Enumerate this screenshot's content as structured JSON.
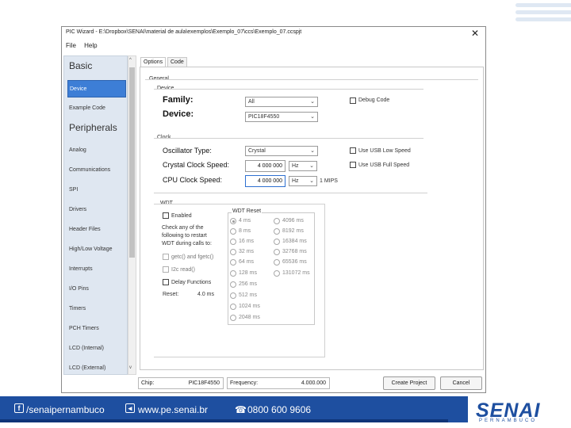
{
  "window": {
    "title": "PIC Wizard - E:\\Dropbox\\SENAI\\material de aula\\exemplos\\Exemplo_07\\ccs\\Exemplo_07.ccspjt",
    "close_glyph": "✕"
  },
  "menu": {
    "file": "File",
    "help": "Help"
  },
  "sidebar": {
    "scroll_up": "^",
    "scroll_down": "v",
    "basic_header": "Basic",
    "peripherals_header": "Peripherals",
    "items": [
      {
        "label": "Device"
      },
      {
        "label": "Example Code"
      },
      {
        "label": "Analog"
      },
      {
        "label": "Communications"
      },
      {
        "label": "SPI"
      },
      {
        "label": "Drivers"
      },
      {
        "label": "Header Files"
      },
      {
        "label": "High/Low Voltage"
      },
      {
        "label": "Interrupts"
      },
      {
        "label": "I/O Pins"
      },
      {
        "label": "Timers"
      },
      {
        "label": "PCH Timers"
      },
      {
        "label": "LCD (Internal)"
      },
      {
        "label": "LCD (External)"
      }
    ]
  },
  "tabs": {
    "options": "Options",
    "code": "Code"
  },
  "general": {
    "group_label": "General",
    "device_group": "Device",
    "family_label": "Family:",
    "family_value": "All",
    "device_label": "Device:",
    "device_value": "PIC18F4550",
    "debug_code": "Debug Code",
    "clock_group": "Clock",
    "osc_label": "Oscillator Type:",
    "osc_value": "Crystal",
    "crystal_label": "Crystal Clock Speed:",
    "crystal_value": "4 000 000",
    "crystal_unit": "Hz",
    "cpu_label": "CPU Clock Speed:",
    "cpu_value": "4 000 000",
    "cpu_unit": "Hz",
    "mips": "1 MIPS",
    "usb_low": "Use USB Low Speed",
    "usb_full": "Use USB Full Speed"
  },
  "wdt": {
    "group_label": "WDT",
    "enabled": "Enabled",
    "check_text_1": "Check any of the",
    "check_text_2": "following to restart",
    "check_text_3": "WDT during calls to:",
    "getc": "getc() and fgetc()",
    "i2c_read": "I2c read()",
    "delay_functions": "Delay Functions",
    "reset_label": "Reset:",
    "reset_value": "4.0 ms",
    "reset_group": "WDT Reset",
    "options_left": [
      "4 ms",
      "8 ms",
      "16 ms",
      "32 ms",
      "64 ms",
      "128 ms",
      "256 ms",
      "512 ms",
      "1024 ms",
      "2048 ms"
    ],
    "options_right": [
      "4096 ms",
      "8192 ms",
      "16384 ms",
      "32768 ms",
      "65536 ms",
      "131072 ms"
    ]
  },
  "status": {
    "chip_label": "Chip:",
    "chip_value": "PIC18F4550",
    "freq_label": "Frequency:",
    "freq_value": "4.000.000",
    "create_button": "Create Project",
    "cancel_button": "Cancel"
  },
  "footer": {
    "facebook": "/senaipernambuco",
    "website": "www.pe.senai.br",
    "phone": "0800 600 9606",
    "fb_glyph": "f",
    "web_glyph": "◂",
    "phone_glyph": "☎",
    "logo": "SENAI",
    "logo_sub": "PERNAMBUCO"
  },
  "colors": {
    "accent": "#1e4fa0",
    "selection": "#3d7ed6",
    "sidebar_bg": "#dfe7f1"
  }
}
